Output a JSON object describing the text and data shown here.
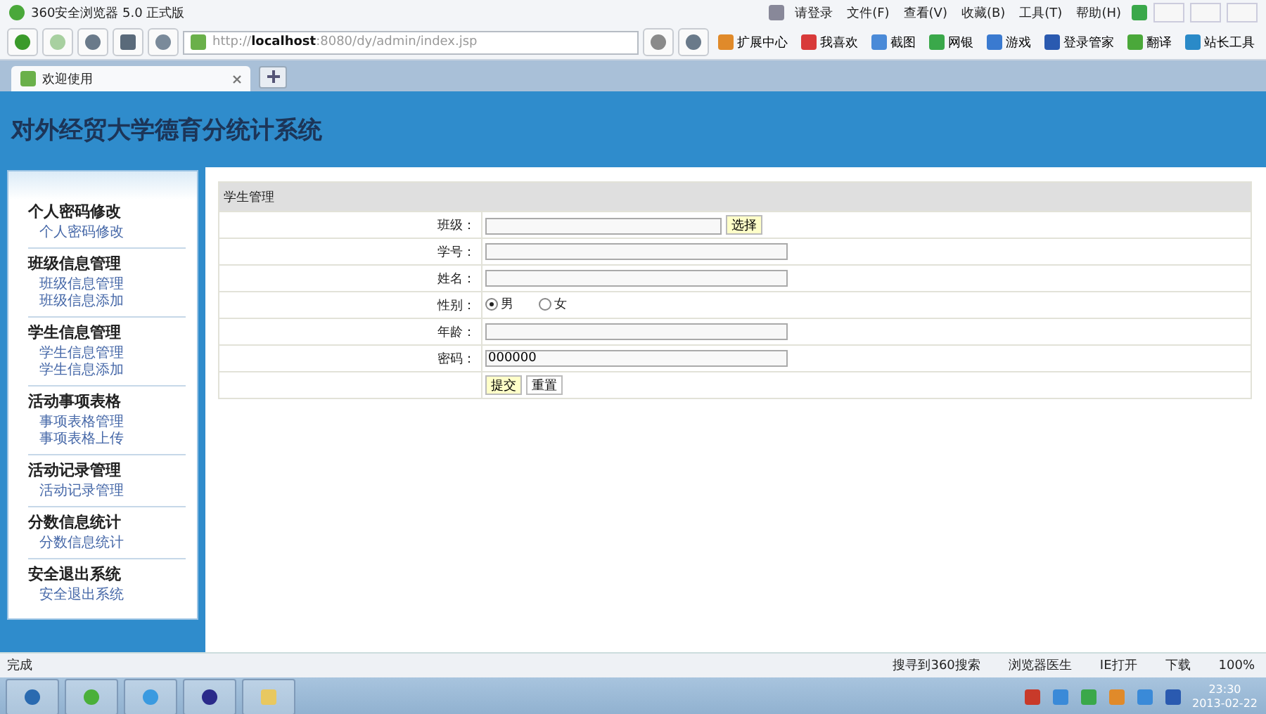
{
  "browser": {
    "title": "360安全浏览器 5.0 正式版",
    "login": "请登录",
    "menu": [
      "文件(F)",
      "查看(V)",
      "收藏(B)",
      "工具(T)",
      "帮助(H)"
    ],
    "address": {
      "prefix": "http://",
      "host": "localhost",
      "rest": ":8080/dy/admin/index.jsp"
    },
    "toolbar": [
      "扩展中心",
      "我喜欢",
      "截图",
      "网银",
      "游戏",
      "登录管家",
      "翻译",
      "站长工具"
    ],
    "tabs": [
      {
        "label": "欢迎使用",
        "selected": true
      }
    ]
  },
  "page": {
    "title": "对外经贸大学德育分统计系统",
    "sidebar": [
      {
        "heading": "个人密码修改",
        "links": [
          "个人密码修改"
        ]
      },
      {
        "heading": "班级信息管理",
        "links": [
          "班级信息管理",
          "班级信息添加"
        ]
      },
      {
        "heading": "学生信息管理",
        "links": [
          "学生信息管理",
          "学生信息添加"
        ]
      },
      {
        "heading": "活动事项表格",
        "links": [
          "事项表格管理",
          "事项表格上传"
        ]
      },
      {
        "heading": "活动记录管理",
        "links": [
          "活动记录管理"
        ]
      },
      {
        "heading": "分数信息统计",
        "links": [
          "分数信息统计"
        ]
      },
      {
        "heading": "安全退出系统",
        "links": [
          "安全退出系统"
        ]
      }
    ],
    "form": {
      "title": "学生管理",
      "fields": [
        {
          "kind": "text",
          "label": "班级：",
          "button": "选择"
        },
        {
          "kind": "text",
          "label": "学号："
        },
        {
          "kind": "text",
          "label": "姓名："
        },
        {
          "kind": "radio",
          "label": "性别：",
          "options": [
            {
              "label": "男",
              "selected": true
            },
            {
              "label": "女",
              "selected": false
            }
          ]
        },
        {
          "kind": "text",
          "label": "年龄："
        },
        {
          "kind": "text",
          "label": "密码：",
          "value": "000000"
        }
      ],
      "buttons": [
        "提交",
        "重置"
      ]
    }
  },
  "status": {
    "text": "完成",
    "items": [
      "搜寻到360搜索",
      "浏览器医生",
      "IE打开",
      "下载",
      "100%"
    ]
  },
  "taskbar": {
    "time": "23:30",
    "date": "2013-02-22"
  }
}
